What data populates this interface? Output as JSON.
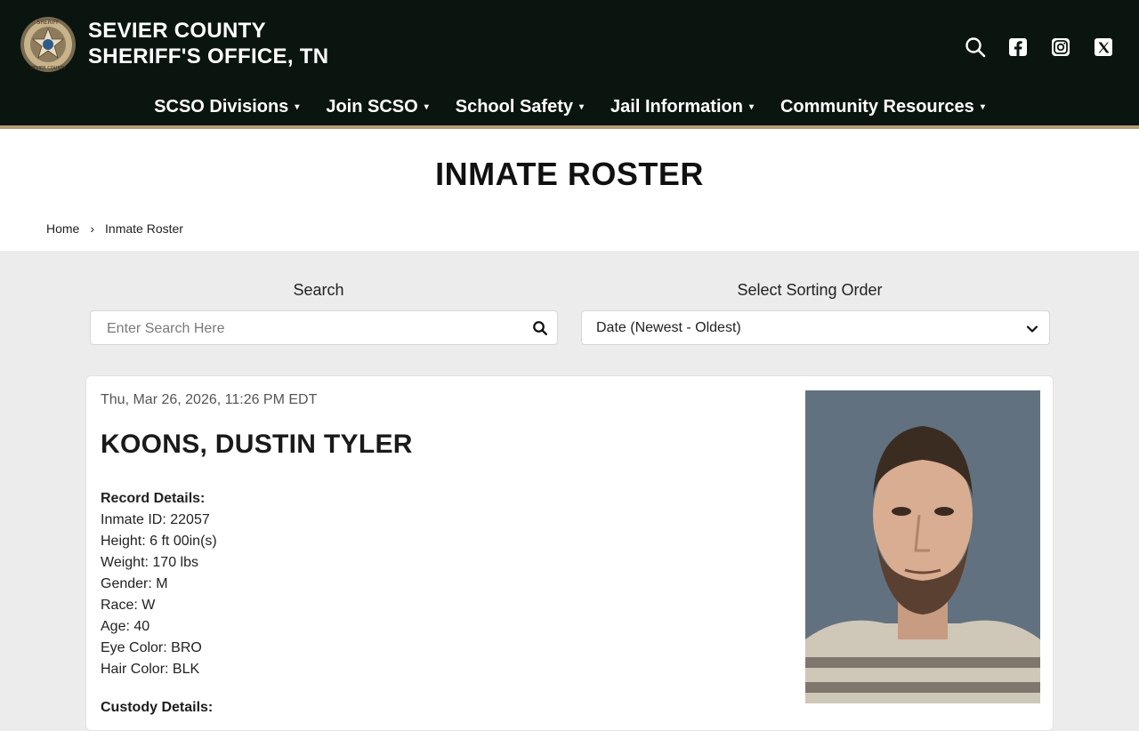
{
  "header": {
    "title_line1": "SEVIER COUNTY",
    "title_line2": "SHERIFF'S OFFICE, TN",
    "logo_text_top": "SHERIFF",
    "logo_text_bottom": "SEVIER COUNTY",
    "icons": [
      "search-icon",
      "facebook-icon",
      "instagram-icon",
      "x-icon"
    ]
  },
  "nav": {
    "items": [
      {
        "label": "SCSO Divisions"
      },
      {
        "label": "Join SCSO"
      },
      {
        "label": "School Safety"
      },
      {
        "label": "Jail Information"
      },
      {
        "label": "Community Resources"
      }
    ],
    "caret": "▾"
  },
  "page": {
    "title": "INMATE ROSTER",
    "breadcrumb": {
      "home": "Home",
      "separator": "›",
      "current": "Inmate Roster"
    }
  },
  "search": {
    "label": "Search",
    "placeholder": "Enter Search Here"
  },
  "sort": {
    "label": "Select Sorting Order",
    "selected": "Date (Newest - Oldest)"
  },
  "inmate": {
    "timestamp": "Thu, Mar 26, 2026, 11:26 PM EDT",
    "name": "KOONS, DUSTIN TYLER",
    "record_heading": "Record Details:",
    "inmate_id": "Inmate ID: 22057",
    "height": "Height: 6 ft 00in(s)",
    "weight": "Weight: 170 lbs",
    "gender": "Gender: M",
    "race": "Race: W",
    "age": "Age: 40",
    "eye_color": "Eye Color: BRO",
    "hair_color": "Hair Color: BLK",
    "custody_heading": "Custody Details:"
  },
  "colors": {
    "header_bg": "#0b1510",
    "accent_bar": "#b09b75",
    "page_bg": "#ececec"
  }
}
